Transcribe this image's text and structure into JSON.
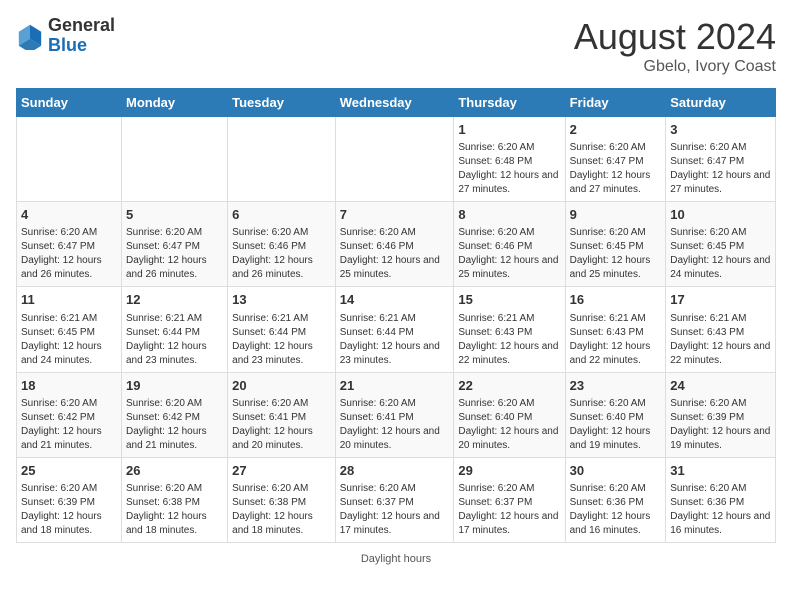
{
  "header": {
    "logo_general": "General",
    "logo_blue": "Blue",
    "main_title": "August 2024",
    "subtitle": "Gbelo, Ivory Coast"
  },
  "days_of_week": [
    "Sunday",
    "Monday",
    "Tuesday",
    "Wednesday",
    "Thursday",
    "Friday",
    "Saturday"
  ],
  "weeks": [
    [
      {
        "day": "",
        "info": ""
      },
      {
        "day": "",
        "info": ""
      },
      {
        "day": "",
        "info": ""
      },
      {
        "day": "",
        "info": ""
      },
      {
        "day": "1",
        "info": "Sunrise: 6:20 AM\nSunset: 6:48 PM\nDaylight: 12 hours and 27 minutes."
      },
      {
        "day": "2",
        "info": "Sunrise: 6:20 AM\nSunset: 6:47 PM\nDaylight: 12 hours and 27 minutes."
      },
      {
        "day": "3",
        "info": "Sunrise: 6:20 AM\nSunset: 6:47 PM\nDaylight: 12 hours and 27 minutes."
      }
    ],
    [
      {
        "day": "4",
        "info": "Sunrise: 6:20 AM\nSunset: 6:47 PM\nDaylight: 12 hours and 26 minutes."
      },
      {
        "day": "5",
        "info": "Sunrise: 6:20 AM\nSunset: 6:47 PM\nDaylight: 12 hours and 26 minutes."
      },
      {
        "day": "6",
        "info": "Sunrise: 6:20 AM\nSunset: 6:46 PM\nDaylight: 12 hours and 26 minutes."
      },
      {
        "day": "7",
        "info": "Sunrise: 6:20 AM\nSunset: 6:46 PM\nDaylight: 12 hours and 25 minutes."
      },
      {
        "day": "8",
        "info": "Sunrise: 6:20 AM\nSunset: 6:46 PM\nDaylight: 12 hours and 25 minutes."
      },
      {
        "day": "9",
        "info": "Sunrise: 6:20 AM\nSunset: 6:45 PM\nDaylight: 12 hours and 25 minutes."
      },
      {
        "day": "10",
        "info": "Sunrise: 6:20 AM\nSunset: 6:45 PM\nDaylight: 12 hours and 24 minutes."
      }
    ],
    [
      {
        "day": "11",
        "info": "Sunrise: 6:21 AM\nSunset: 6:45 PM\nDaylight: 12 hours and 24 minutes."
      },
      {
        "day": "12",
        "info": "Sunrise: 6:21 AM\nSunset: 6:44 PM\nDaylight: 12 hours and 23 minutes."
      },
      {
        "day": "13",
        "info": "Sunrise: 6:21 AM\nSunset: 6:44 PM\nDaylight: 12 hours and 23 minutes."
      },
      {
        "day": "14",
        "info": "Sunrise: 6:21 AM\nSunset: 6:44 PM\nDaylight: 12 hours and 23 minutes."
      },
      {
        "day": "15",
        "info": "Sunrise: 6:21 AM\nSunset: 6:43 PM\nDaylight: 12 hours and 22 minutes."
      },
      {
        "day": "16",
        "info": "Sunrise: 6:21 AM\nSunset: 6:43 PM\nDaylight: 12 hours and 22 minutes."
      },
      {
        "day": "17",
        "info": "Sunrise: 6:21 AM\nSunset: 6:43 PM\nDaylight: 12 hours and 22 minutes."
      }
    ],
    [
      {
        "day": "18",
        "info": "Sunrise: 6:20 AM\nSunset: 6:42 PM\nDaylight: 12 hours and 21 minutes."
      },
      {
        "day": "19",
        "info": "Sunrise: 6:20 AM\nSunset: 6:42 PM\nDaylight: 12 hours and 21 minutes."
      },
      {
        "day": "20",
        "info": "Sunrise: 6:20 AM\nSunset: 6:41 PM\nDaylight: 12 hours and 20 minutes."
      },
      {
        "day": "21",
        "info": "Sunrise: 6:20 AM\nSunset: 6:41 PM\nDaylight: 12 hours and 20 minutes."
      },
      {
        "day": "22",
        "info": "Sunrise: 6:20 AM\nSunset: 6:40 PM\nDaylight: 12 hours and 20 minutes."
      },
      {
        "day": "23",
        "info": "Sunrise: 6:20 AM\nSunset: 6:40 PM\nDaylight: 12 hours and 19 minutes."
      },
      {
        "day": "24",
        "info": "Sunrise: 6:20 AM\nSunset: 6:39 PM\nDaylight: 12 hours and 19 minutes."
      }
    ],
    [
      {
        "day": "25",
        "info": "Sunrise: 6:20 AM\nSunset: 6:39 PM\nDaylight: 12 hours and 18 minutes."
      },
      {
        "day": "26",
        "info": "Sunrise: 6:20 AM\nSunset: 6:38 PM\nDaylight: 12 hours and 18 minutes."
      },
      {
        "day": "27",
        "info": "Sunrise: 6:20 AM\nSunset: 6:38 PM\nDaylight: 12 hours and 18 minutes."
      },
      {
        "day": "28",
        "info": "Sunrise: 6:20 AM\nSunset: 6:37 PM\nDaylight: 12 hours and 17 minutes."
      },
      {
        "day": "29",
        "info": "Sunrise: 6:20 AM\nSunset: 6:37 PM\nDaylight: 12 hours and 17 minutes."
      },
      {
        "day": "30",
        "info": "Sunrise: 6:20 AM\nSunset: 6:36 PM\nDaylight: 12 hours and 16 minutes."
      },
      {
        "day": "31",
        "info": "Sunrise: 6:20 AM\nSunset: 6:36 PM\nDaylight: 12 hours and 16 minutes."
      }
    ]
  ],
  "footer": {
    "daylight_label": "Daylight hours"
  }
}
